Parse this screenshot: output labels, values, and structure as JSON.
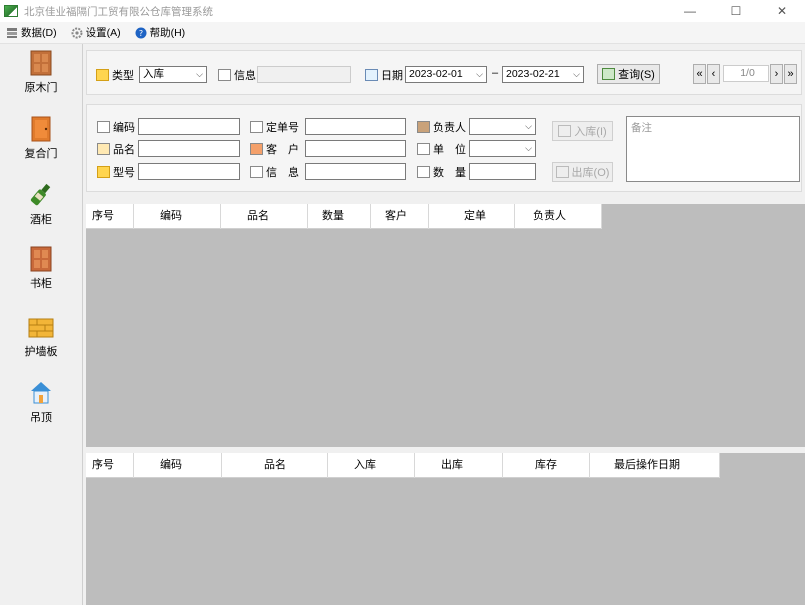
{
  "window": {
    "title": "北京佳业福隔门工贸有限公仓库管理系统",
    "minimize": "—",
    "maximize": "☐",
    "close": "✕"
  },
  "menu": {
    "items": [
      {
        "label": "数据(D)",
        "icon": "database-icon"
      },
      {
        "label": "设置(A)",
        "icon": "gear-icon"
      },
      {
        "label": "帮助(H)",
        "icon": "help-icon"
      }
    ]
  },
  "sidebar": {
    "items": [
      {
        "label": "原木门",
        "icon": "wood-door-icon"
      },
      {
        "label": "复合门",
        "icon": "composite-door-icon"
      },
      {
        "label": "酒柜",
        "icon": "wine-bottle-icon"
      },
      {
        "label": "书柜",
        "icon": "bookcase-icon"
      },
      {
        "label": "护墙板",
        "icon": "wall-panel-icon"
      },
      {
        "label": "吊顶",
        "icon": "ceiling-house-icon"
      }
    ]
  },
  "topbar": {
    "type_label": "类型",
    "type_value": "入库",
    "info_label": "信息",
    "info_value": "",
    "date_label": "日期",
    "date_from": "2023-02-01",
    "date_sep": "–",
    "date_to": "2023-02-21",
    "query_label": "查询(S)",
    "page_indicator": "1/0",
    "first_page": "«",
    "prev_page": "‹",
    "next_page": "›",
    "last_page": "»"
  },
  "filters": {
    "code_label": "编码",
    "name_label": "品名",
    "model_label": "型号",
    "order_label": "定单号",
    "customer_label": "客　户",
    "info_label": "信　息",
    "owner_label": "负责人",
    "unit_label": "单　位",
    "qty_label": "数　量",
    "code_value": "",
    "name_value": "",
    "model_value": "",
    "order_value": "",
    "customer_value": "",
    "info_value": "",
    "owner_value": "",
    "unit_value": "",
    "qty_value": "",
    "in_button": "入库(I)",
    "out_button": "出库(O)",
    "remark_placeholder": "备注"
  },
  "upper_table": {
    "columns": [
      "序号",
      "编码",
      "品名",
      "数量",
      "客户",
      "定单",
      "负责人"
    ]
  },
  "lower_table": {
    "columns": [
      "序号",
      "编码",
      "品名",
      "入库",
      "出库",
      "库存",
      "最后操作日期"
    ]
  }
}
